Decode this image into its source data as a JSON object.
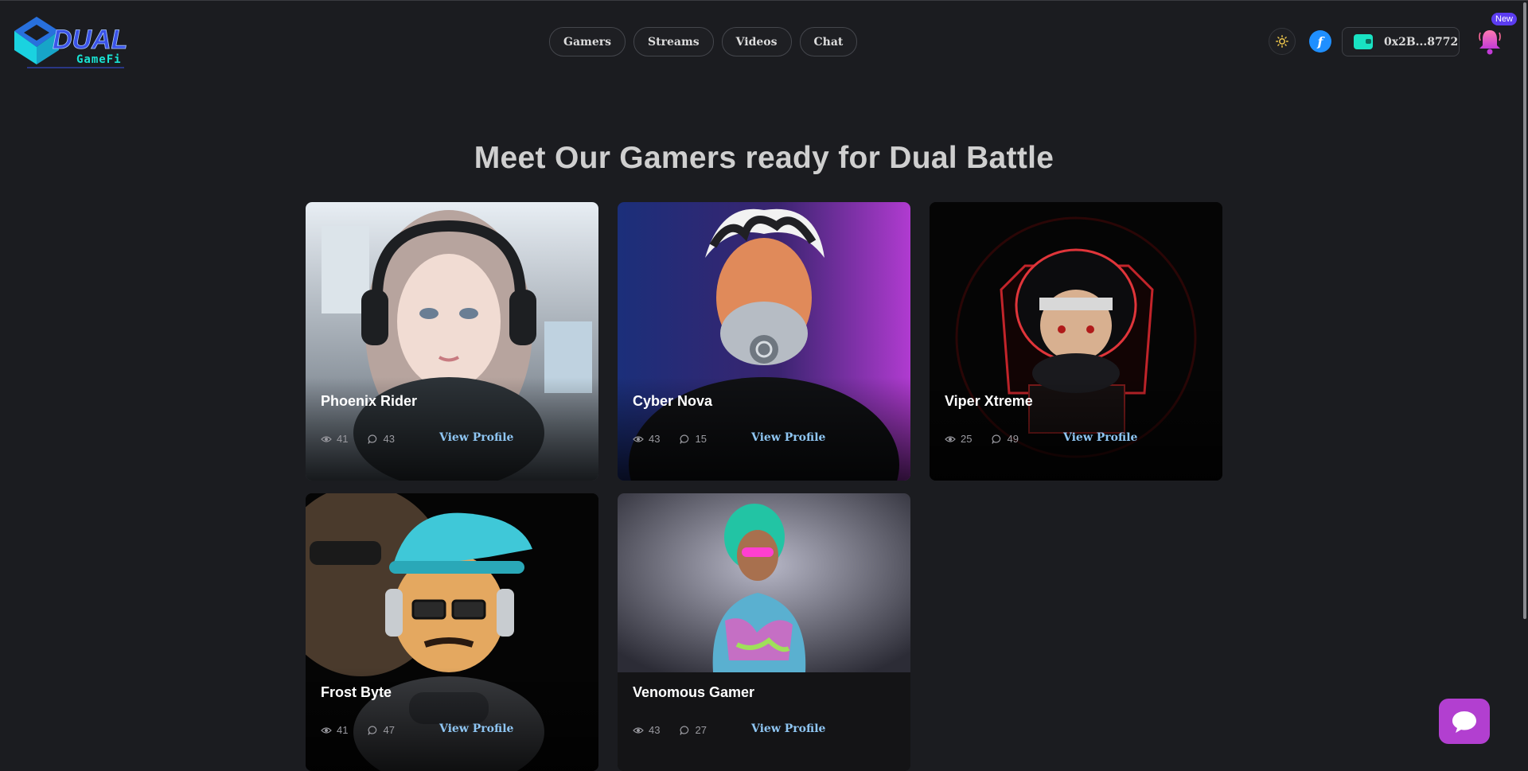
{
  "header": {
    "logo_title": "DUAL",
    "logo_subtitle": "GameFi",
    "nav": [
      "Gamers",
      "Streams",
      "Videos",
      "Chat"
    ],
    "theme_icon": "sun-icon",
    "chain_symbol": "f",
    "wallet_address": "0x2B...8772",
    "notification_badge": "New"
  },
  "main": {
    "title": "Meet Our Gamers ready for Dual Battle",
    "view_profile_label": "View Profile",
    "gamers": [
      {
        "name": "Phoenix Rider",
        "views": "41",
        "comments": "43"
      },
      {
        "name": "Cyber Nova",
        "views": "43",
        "comments": "15"
      },
      {
        "name": "Viper Xtreme",
        "views": "25",
        "comments": "49"
      },
      {
        "name": "Frost Byte",
        "views": "41",
        "comments": "47"
      },
      {
        "name": "Venomous Gamer",
        "views": "43",
        "comments": "27"
      }
    ]
  },
  "colors": {
    "background": "#1b1c20",
    "accent_cyan": "#19e3d3",
    "link_blue": "#8ec5f2",
    "chat_fab": "#b23fd0",
    "chain_blue": "#1f8fff"
  }
}
